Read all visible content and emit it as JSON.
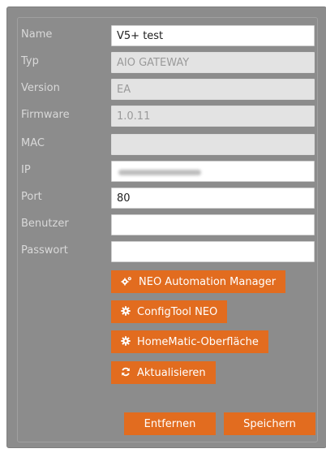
{
  "form": {
    "name": {
      "label": "Name",
      "value": "V5+ test"
    },
    "typ": {
      "label": "Typ",
      "value": "AIO GATEWAY"
    },
    "version": {
      "label": "Version",
      "value": "EA"
    },
    "firmware": {
      "label": "Firmware",
      "value": "1.0.11"
    },
    "mac": {
      "label": "MAC",
      "value": ""
    },
    "ip": {
      "label": "IP",
      "value": ""
    },
    "port": {
      "label": "Port",
      "value": "80"
    },
    "benutzer": {
      "label": "Benutzer",
      "value": ""
    },
    "passwort": {
      "label": "Passwort",
      "value": ""
    }
  },
  "actions": {
    "neo_manager": {
      "label": "NEO Automation Manager",
      "icon": "cogs-icon"
    },
    "configtool": {
      "label": "ConfigTool NEO",
      "icon": "gear-icon"
    },
    "homematic": {
      "label": "HomeMatic-Oberfläche",
      "icon": "gear-icon"
    },
    "refresh": {
      "label": "Aktualisieren",
      "icon": "refresh-icon"
    }
  },
  "footer": {
    "remove_label": "Entfernen",
    "save_label": "Speichern"
  },
  "colors": {
    "accent": "#e26c1f",
    "panel": "#8c8c8c",
    "readonly_field": "#e3e3e3"
  }
}
